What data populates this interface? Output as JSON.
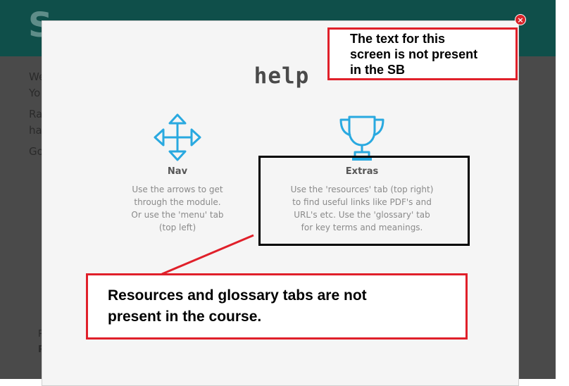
{
  "background": {
    "title_letter": "S",
    "lines": [
      "We",
      "Yo",
      "Ra",
      "ha",
      "Go"
    ],
    "footer": [
      "P",
      "P"
    ]
  },
  "modal": {
    "close_glyph": "×",
    "title": "help",
    "nav": {
      "heading": "Nav",
      "description": [
        "Use the arrows to get",
        "through the module.",
        "Or use the 'menu' tab",
        "(top left)"
      ]
    },
    "extras": {
      "heading": "Extras",
      "description": [
        "Use the 'resources' tab (top right)",
        "to find useful links like PDF's and",
        "URL's etc. Use the 'glossary' tab",
        "for key terms and meanings."
      ]
    },
    "icons": {
      "nav": "move-arrows-icon",
      "extras": "trophy-icon"
    },
    "accent_color": "#29a9e0"
  },
  "annotations": {
    "top_note": [
      "The text for this",
      "screen is not present",
      "in the SB"
    ],
    "bottom_note": [
      "Resources and glossary tabs are not",
      "present in the course."
    ],
    "color": "#e0202a"
  }
}
